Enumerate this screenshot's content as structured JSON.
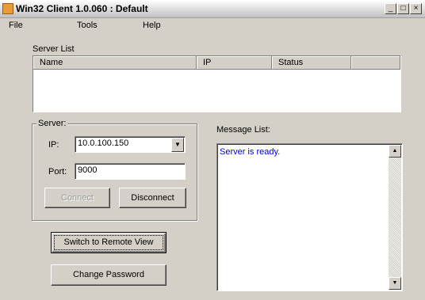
{
  "window": {
    "title": "Win32 Client 1.0.060 : Default"
  },
  "menu": {
    "items": [
      "File",
      "Tools",
      "Help"
    ]
  },
  "server_list": {
    "label": "Server List",
    "columns": [
      "Name",
      "IP",
      "Status"
    ]
  },
  "server_group": {
    "label": "Server:",
    "ip_label": "IP:",
    "ip_value": "10.0.100.150",
    "port_label": "Port:",
    "port_value": "9000",
    "connect_label": "Connect",
    "disconnect_label": "Disconnect"
  },
  "actions": {
    "switch_label": "Switch to Remote View",
    "change_password_label": "Change Password"
  },
  "messages": {
    "label": "Message List:",
    "items": [
      "Server is ready."
    ]
  },
  "controls": {
    "minimize": "_",
    "maximize": "□",
    "close": "×"
  }
}
